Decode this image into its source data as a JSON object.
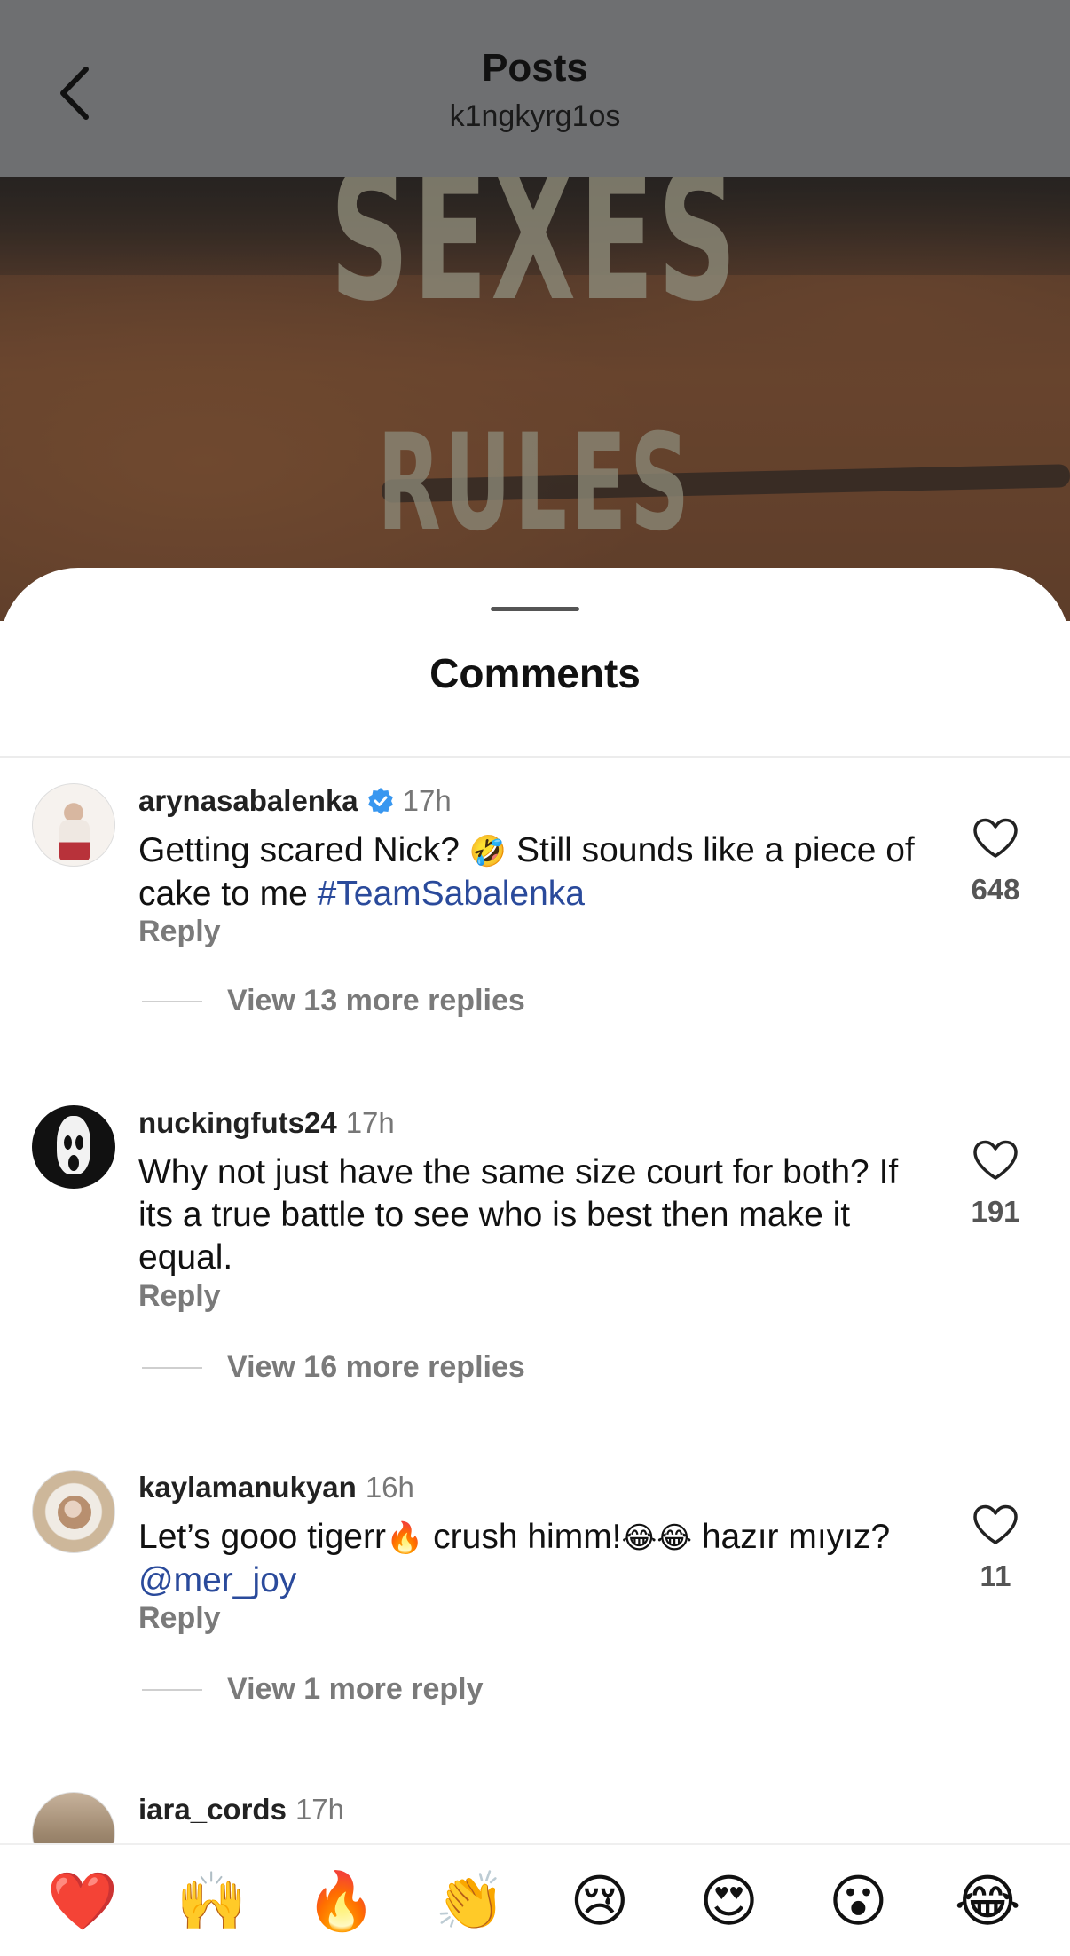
{
  "header": {
    "title": "Posts",
    "subtitle": "k1ngkyrg1os"
  },
  "post_image": {
    "text_line_1": "SEXES",
    "text_line_2": "RULES"
  },
  "comments_sheet": {
    "title": "Comments"
  },
  "comments": [
    {
      "username": "arynasabalenka",
      "verified": true,
      "time": "17h",
      "text_before": "Getting scared Nick? ",
      "emoji": "🤣",
      "text_middle": " Still sounds like a piece of cake to me ",
      "hashtag": "#TeamSabalenka",
      "likes": "648",
      "reply_label": "Reply",
      "view_replies": "View 13 more replies"
    },
    {
      "username": "nuckingfuts24",
      "time": "17h",
      "text": "Why not just have the same size court for both? If its a true battle to see who is best then make it equal.",
      "likes": "191",
      "reply_label": "Reply",
      "view_replies": "View 16 more replies"
    },
    {
      "username": "kaylamanukyan",
      "time": "16h",
      "text_before": "Let’s gooo tigerr",
      "emoji_1": "🔥",
      "text_middle": " crush himm!",
      "emoji_2": "😂😂",
      "text_after": " hazır mıyız? ",
      "mention": "@mer_joy",
      "likes": "11",
      "reply_label": "Reply",
      "view_replies": "View 1 more reply"
    },
    {
      "username": "iara_cords",
      "time": "17h"
    }
  ],
  "reactions": [
    "❤️",
    "🙌",
    "🔥",
    "👏",
    "😢",
    "😍",
    "😮",
    "😂"
  ],
  "colors": {
    "header_bg": "#6e6f71",
    "hashtag": "#2a4a9b",
    "verified": "#3897f0"
  }
}
